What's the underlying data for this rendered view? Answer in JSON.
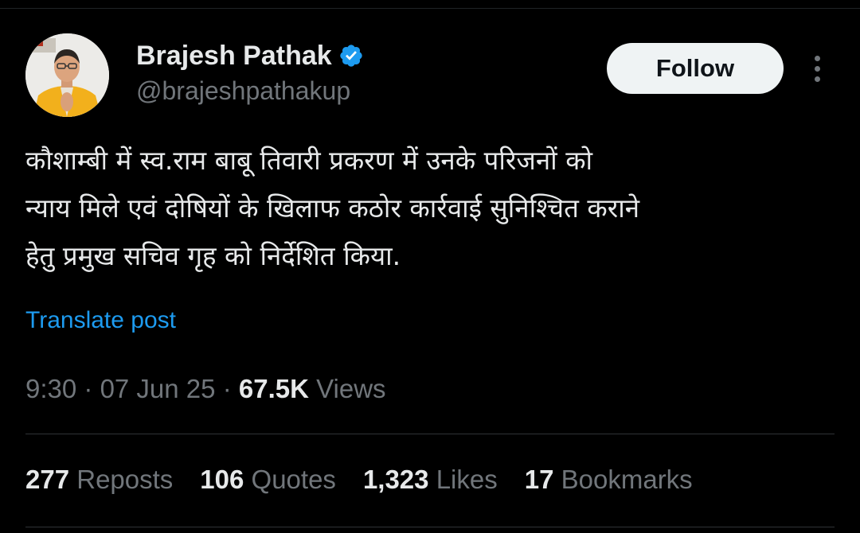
{
  "author": {
    "display_name": "Brajesh Pathak",
    "handle": "@brajeshpathakup",
    "verified_icon": "verified-badge-icon",
    "avatar_icon": "profile-avatar"
  },
  "actions": {
    "follow_label": "Follow",
    "more_icon": "more-vertical-icon"
  },
  "tweet": {
    "lines": [
      "कौशाम्बी में स्व.राम बाबू तिवारी प्रकरण में उनके परिजनों को",
      "न्याय मिले एवं दोषियों के खिलाफ कठोर कार्रवाई सुनिश्चित कराने",
      "हेतु प्रमुख सचिव गृह को निर्देशित किया."
    ],
    "translate_label": "Translate post"
  },
  "meta": {
    "time": "9:30",
    "sep1": " · ",
    "date": "07 Jun 25",
    "sep2": " · ",
    "views_count": "67.5K",
    "views_label": " Views"
  },
  "stats": [
    {
      "count": "277",
      "label": " Reposts"
    },
    {
      "count": "106",
      "label": " Quotes"
    },
    {
      "count": "1,323",
      "label": " Likes"
    },
    {
      "count": "17",
      "label": " Bookmarks"
    }
  ],
  "colors": {
    "background": "#000000",
    "primary_text": "#e7e9ea",
    "secondary_text": "#71767b",
    "link": "#1d9bf0",
    "verified": "#1d9bf0",
    "divider": "#2f3336"
  }
}
